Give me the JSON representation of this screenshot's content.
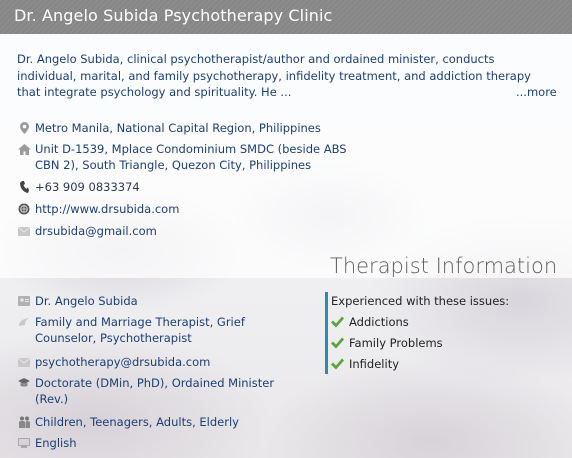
{
  "header": {
    "title": "Dr. Angelo Subida Psychotherapy Clinic"
  },
  "description": {
    "text": "Dr. Angelo Subida, clinical psychotherapist/author and ordained minister, conducts individual, marital, and family psychotherapy, infidelity treatment, and addiction therapy that integrate psychology and spirituality. He ...",
    "more_label": "...more"
  },
  "contact": {
    "location": "Metro Manila, National Capital Region, Philippines",
    "address": "Unit D-1539, Mplace Condominium SMDC (beside ABS CBN 2), South Triangle, Quezon City, Philippines",
    "phone": "+63 909 0833374",
    "website": "http://www.drsubida.com",
    "email": "drsubida@gmail.com"
  },
  "therapist": {
    "section_title": "Therapist Information",
    "name": "Dr. Angelo Subida",
    "titles": "Family and Marriage Therapist, Grief Counselor, Psychotherapist",
    "email": "psychotherapy@drsubida.com",
    "degree": "Doctorate (DMin, PhD), Ordained Minister (Rev.)",
    "ages": "Children, Teenagers, Adults, Elderly",
    "language": "English"
  },
  "issues": {
    "title": "Experienced with these issues:",
    "items": [
      "Addictions",
      "Family Problems",
      "Infidelity"
    ],
    "check_color": "#5aa53a"
  },
  "colors": {
    "link": "#1c3f74",
    "accent_bar": "#2b8bb5",
    "header_bg": "#8a8a8a"
  },
  "icons": [
    "map-pin-icon",
    "home-icon",
    "phone-icon",
    "globe-icon",
    "envelope-icon",
    "person-icon",
    "speech-icon",
    "graduation-cap-icon",
    "people-icon",
    "language-icon",
    "checkmark-icon"
  ]
}
